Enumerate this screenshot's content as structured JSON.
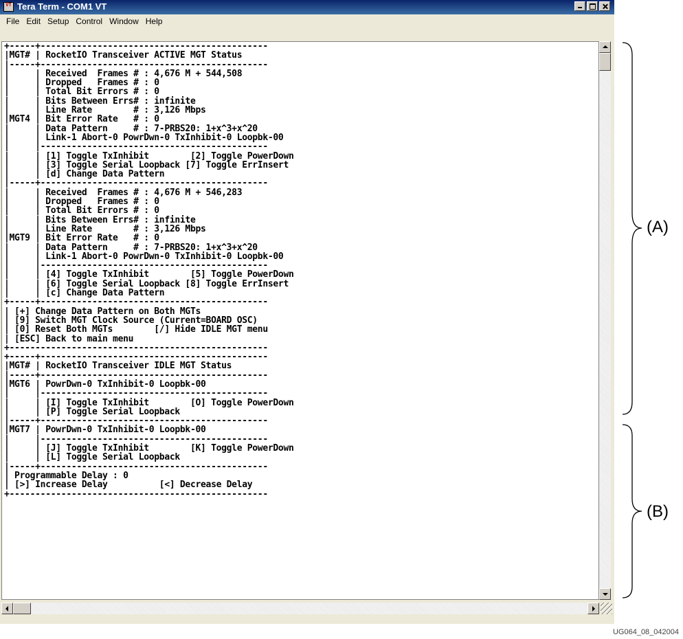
{
  "window": {
    "title": "Tera Term - COM1 VT",
    "icon_glyph": "VT"
  },
  "menu": [
    "File",
    "Edit",
    "Setup",
    "Control",
    "Window",
    "Help"
  ],
  "terminal": {
    "lines": [
      "+-----+--------------------------------------------",
      "|MGT# | RocketIO Transceiver ACTIVE MGT Status",
      "|-----+--------------------------------------------",
      "|     | Received  Frames # : 4,676 M + 544,508",
      "|     | Dropped   Frames # : 0",
      "|     | Total Bit Errors # : 0",
      "|     | Bits Between Errs# : infinite",
      "|     | Line Rate        # : 3,126 Mbps",
      "|MGT4 | Bit Error Rate   # : 0",
      "|     | Data Pattern     # : 7-PRBS20: 1+x^3+x^20",
      "|     | Link-1 Abort-0 PowrDwn-0 TxInhibit-0 Loopbk-00",
      "|     |--------------------------------------------",
      "|     | [1] Toggle TxInhibit        [2] Toggle PowerDown",
      "|     | [3] Toggle Serial Loopback [7] Toggle ErrInsert",
      "|     | [d] Change Data Pattern",
      "|-----+--------------------------------------------",
      "|     | Received  Frames # : 4,676 M + 546,283",
      "|     | Dropped   Frames # : 0",
      "|     | Total Bit Errors # : 0",
      "|     | Bits Between Errs# : infinite",
      "|     | Line Rate        # : 3,126 Mbps",
      "|MGT9 | Bit Error Rate   # : 0",
      "|     | Data Pattern     # : 7-PRBS20: 1+x^3+x^20",
      "|     | Link-1 Abort-0 PowrDwn-0 TxInhibit-0 Loopbk-00",
      "|     |--------------------------------------------",
      "|     | [4] Toggle TxInhibit        [5] Toggle PowerDown",
      "|     | [6] Toggle Serial Loopback [8] Toggle ErrInsert",
      "|     | [c] Change Data Pattern",
      "+-----+--------------------------------------------",
      "| [+] Change Data Pattern on Both MGTs",
      "| [9] Switch MGT Clock Source (Current=BOARD OSC)",
      "| [0] Reset Both MGTs        [/] Hide IDLE MGT menu",
      "| [ESC] Back to main menu",
      "+--------------------------------------------------",
      "+-----+--------------------------------------------",
      "|MGT# | RocketIO Transceiver IDLE MGT Status",
      "|-----+--------------------------------------------",
      "|MGT6 | PowrDwn-0 TxInhibit-0 Loopbk-00",
      "|     |--------------------------------------------",
      "|     | [I] Toggle TxInhibit        [O] Toggle PowerDown",
      "|     | [P] Toggle Serial Loopback",
      "|-----+--------------------------------------------",
      "|MGT7 | PowrDwn-0 TxInhibit-0 Loopbk-00",
      "|     |--------------------------------------------",
      "|     | [J] Toggle TxInhibit        [K] Toggle PowerDown",
      "|     | [L] Toggle Serial Loopback",
      "|-----+--------------------------------------------",
      "| Programmable Delay : 0",
      "| [>] Increase Delay          [<] Decrease Delay",
      "+--------------------------------------------------"
    ]
  },
  "annotations": {
    "brace_a_label": "(A)",
    "brace_b_label": "(B)",
    "figure_id": "UG064_08_042004"
  }
}
